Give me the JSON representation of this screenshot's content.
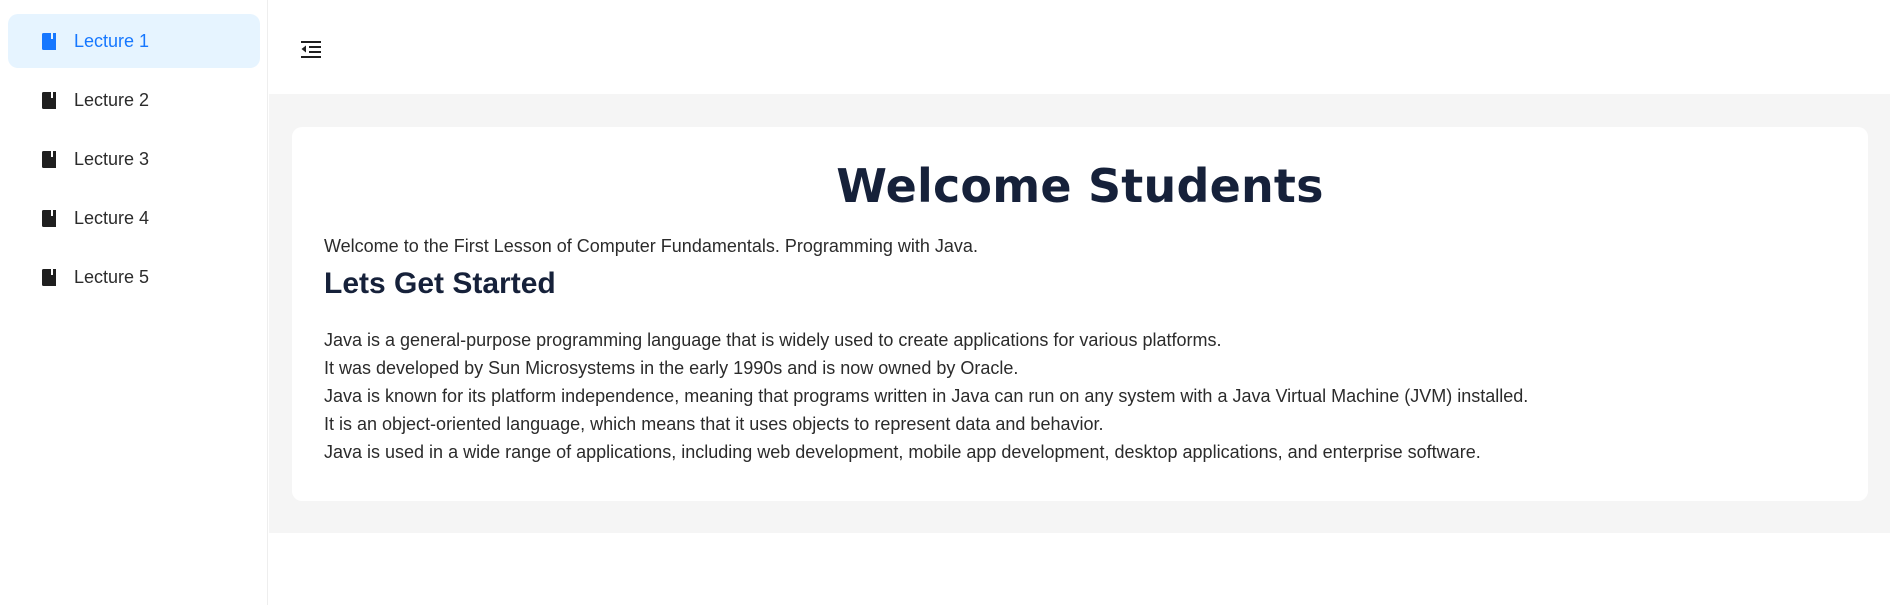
{
  "sidebar": {
    "items": [
      {
        "label": "Lecture 1",
        "icon": "book-icon",
        "active": true
      },
      {
        "label": "Lecture 2",
        "icon": "book-icon",
        "active": false
      },
      {
        "label": "Lecture 3",
        "icon": "book-icon",
        "active": false
      },
      {
        "label": "Lecture 4",
        "icon": "book-icon",
        "active": false
      },
      {
        "label": "Lecture 5",
        "icon": "book-icon",
        "active": false
      }
    ]
  },
  "header": {
    "toggle_icon": "menu-fold-icon"
  },
  "main": {
    "title": "Welcome Students",
    "intro": "Welcome to the First Lesson of Computer Fundamentals. Programming with Java.",
    "section_heading": "Lets Get Started",
    "paragraphs": [
      "Java is a general-purpose programming language that is widely used to create applications for various platforms.",
      "It was developed by Sun Microsystems in the early 1990s and is now owned by Oracle.",
      "Java is known for its platform independence, meaning that programs written in Java can run on any system with a Java Virtual Machine (JVM) installed.",
      "It is an object-oriented language, which means that it uses objects to represent data and behavior.",
      "Java is used in a wide range of applications, including web development, mobile app development, desktop applications, and enterprise software."
    ]
  },
  "colors": {
    "accent": "#1677ff",
    "active_bg": "#e6f4ff",
    "content_bg": "#f5f5f5",
    "heading": "#16213a"
  }
}
